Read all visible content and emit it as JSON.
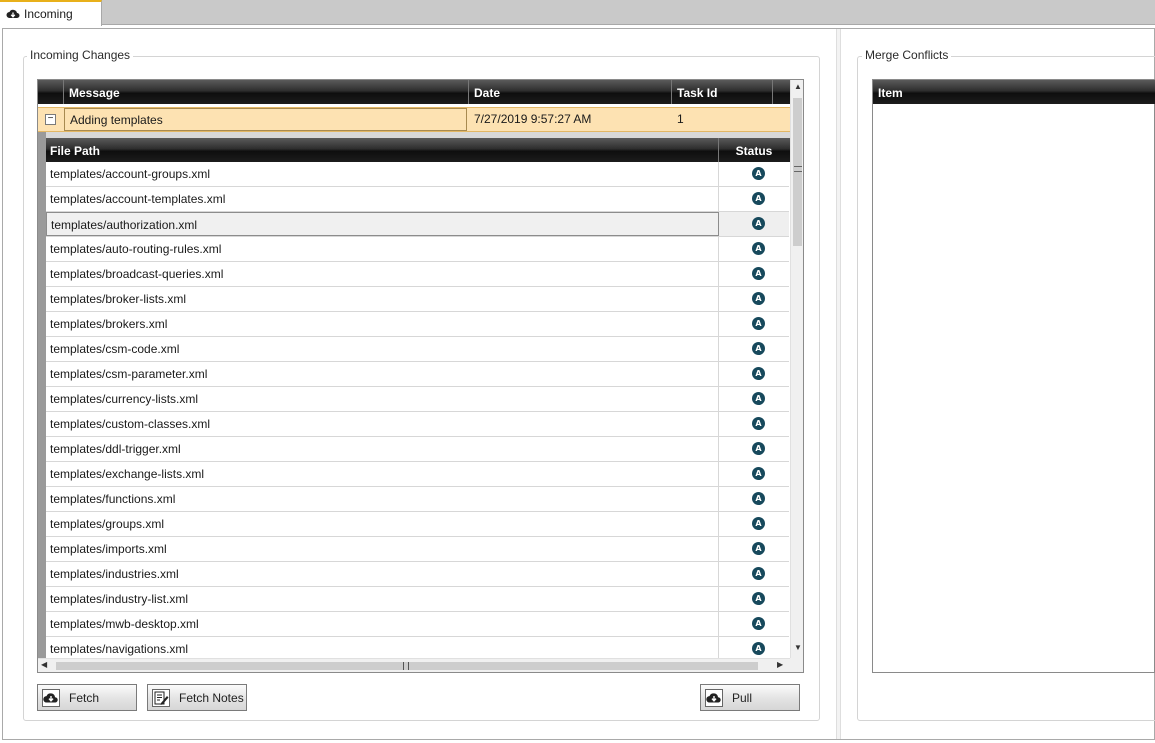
{
  "tab": {
    "label": "Incoming",
    "icon": "cloud-download-icon"
  },
  "incoming": {
    "group_label": "Incoming Changes",
    "columns": [
      "Message",
      "Date",
      "Task Id"
    ],
    "row": {
      "message": "Adding templates",
      "date": "7/27/2019 9:57:27 AM",
      "task_id": "1",
      "expander": "−"
    },
    "detail_columns": [
      "File Path",
      "Status"
    ],
    "files": [
      {
        "path": "templates/account-groups.xml",
        "status": "A"
      },
      {
        "path": "templates/account-templates.xml",
        "status": "A"
      },
      {
        "path": "templates/authorization.xml",
        "status": "A"
      },
      {
        "path": "templates/auto-routing-rules.xml",
        "status": "A"
      },
      {
        "path": "templates/broadcast-queries.xml",
        "status": "A"
      },
      {
        "path": "templates/broker-lists.xml",
        "status": "A"
      },
      {
        "path": "templates/brokers.xml",
        "status": "A"
      },
      {
        "path": "templates/csm-code.xml",
        "status": "A"
      },
      {
        "path": "templates/csm-parameter.xml",
        "status": "A"
      },
      {
        "path": "templates/currency-lists.xml",
        "status": "A"
      },
      {
        "path": "templates/custom-classes.xml",
        "status": "A"
      },
      {
        "path": "templates/ddl-trigger.xml",
        "status": "A"
      },
      {
        "path": "templates/exchange-lists.xml",
        "status": "A"
      },
      {
        "path": "templates/functions.xml",
        "status": "A"
      },
      {
        "path": "templates/groups.xml",
        "status": "A"
      },
      {
        "path": "templates/imports.xml",
        "status": "A"
      },
      {
        "path": "templates/industries.xml",
        "status": "A"
      },
      {
        "path": "templates/industry-list.xml",
        "status": "A"
      },
      {
        "path": "templates/mwb-desktop.xml",
        "status": "A"
      },
      {
        "path": "templates/navigations.xml",
        "status": "A"
      }
    ],
    "selected_file": "templates/authorization.xml"
  },
  "buttons": {
    "fetch": "Fetch",
    "fetch_notes": "Fetch Notes",
    "pull": "Pull"
  },
  "merge": {
    "group_label": "Merge Conflicts",
    "columns": [
      "Item"
    ]
  },
  "colors": {
    "tab_accent": "#e8b01a",
    "selected_row": "#fde2b2",
    "status_badge": "#17495c"
  }
}
